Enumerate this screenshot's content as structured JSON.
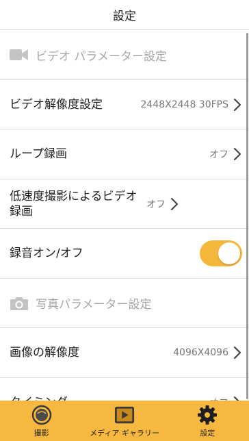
{
  "header": {
    "title": "設定"
  },
  "video_section": {
    "title": "ビデオ パラメーター設定",
    "icon": "video-camera-icon",
    "rows": [
      {
        "label": "ビデオ解像度設定",
        "value": "2448X2448 30FPS"
      },
      {
        "label": "ループ録画",
        "value": "オフ"
      },
      {
        "label": "低速度撮影によるビデオ録画",
        "value": "オフ"
      }
    ],
    "audio_toggle": {
      "label": "録音オン/オフ",
      "state": "on"
    }
  },
  "photo_section": {
    "title": "写真パラメーター設定",
    "icon": "photo-camera-icon",
    "rows": [
      {
        "label": "画像の解像度",
        "value": "4096X4096"
      },
      {
        "label": "タイミング",
        "value": "オフ"
      }
    ]
  },
  "tabbar": {
    "tabs": [
      {
        "label": "撮影",
        "icon": "shutter-icon"
      },
      {
        "label": "メディア ギャラリー",
        "icon": "media-gallery-icon"
      },
      {
        "label": "設定",
        "icon": "gear-icon",
        "selected": true
      }
    ]
  },
  "colors": {
    "accent": "#f6b83e",
    "toggle_on": "#f5b73b",
    "section_text": "#a6a6a6",
    "divider": "#dcdcdc"
  }
}
